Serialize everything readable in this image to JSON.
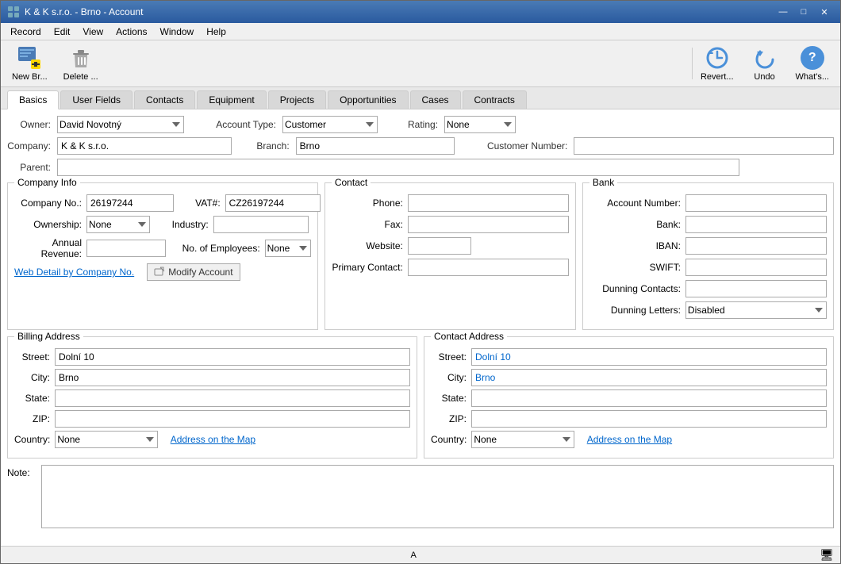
{
  "titlebar": {
    "icon": "⚙",
    "title": "K & K s.r.o. - Brno - Account",
    "minimize": "—",
    "maximize": "□",
    "close": "✕"
  },
  "menubar": {
    "items": [
      "Record",
      "Edit",
      "View",
      "Actions",
      "Window",
      "Help"
    ]
  },
  "toolbar": {
    "new_br_label": "New Br...",
    "delete_label": "Delete ...",
    "revert_label": "Revert...",
    "undo_label": "Undo",
    "whats_label": "What's..."
  },
  "tabs": [
    "Basics",
    "User Fields",
    "Contacts",
    "Equipment",
    "Projects",
    "Opportunities",
    "Cases",
    "Contracts"
  ],
  "active_tab": "Basics",
  "form": {
    "owner_label": "Owner:",
    "owner_value": "David Novotný",
    "account_type_label": "Account Type:",
    "account_type_value": "Customer",
    "rating_label": "Rating:",
    "rating_value": "None",
    "company_label": "Company:",
    "company_value": "K & K s.r.o.",
    "branch_label": "Branch:",
    "branch_value": "Brno",
    "customer_number_label": "Customer Number:",
    "customer_number_value": "",
    "parent_label": "Parent:",
    "parent_value": ""
  },
  "company_info": {
    "title": "Company Info",
    "company_no_label": "Company No.:",
    "company_no_value": "26197244",
    "vat_label": "VAT#:",
    "vat_value": "CZ26197244",
    "ownership_label": "Ownership:",
    "ownership_value": "None",
    "industry_label": "Industry:",
    "industry_value": "",
    "annual_revenue_label": "Annual Revenue:",
    "annual_revenue_value": "",
    "no_employees_label": "No. of Employees:",
    "no_employees_value": "None",
    "web_detail_link": "Web Detail by Company No.",
    "modify_account_label": "Modify Account"
  },
  "contact_section": {
    "title": "Contact",
    "phone_label": "Phone:",
    "phone_value": "",
    "fax_label": "Fax:",
    "fax_value": "",
    "website_label": "Website:",
    "website_value": "",
    "primary_contact_label": "Primary Contact:",
    "primary_contact_value": ""
  },
  "bank_section": {
    "title": "Bank",
    "account_number_label": "Account Number:",
    "account_number_value": "",
    "bank_label": "Bank:",
    "bank_value": "",
    "iban_label": "IBAN:",
    "iban_value": "",
    "swift_label": "SWIFT:",
    "swift_value": "",
    "dunning_contacts_label": "Dunning Contacts:",
    "dunning_contacts_value": "",
    "dunning_letters_label": "Dunning Letters:",
    "dunning_letters_value": "Disabled"
  },
  "billing_address": {
    "title": "Billing Address",
    "street_label": "Street:",
    "street_value": "Dolní 10",
    "city_label": "City:",
    "city_value": "Brno",
    "state_label": "State:",
    "state_value": "",
    "zip_label": "ZIP:",
    "zip_value": "",
    "country_label": "Country:",
    "country_value": "None",
    "map_link": "Address on the Map"
  },
  "contact_address": {
    "title": "Contact Address",
    "street_label": "Street:",
    "street_value": "Dolní 10",
    "city_label": "City:",
    "city_value": "Brno",
    "state_label": "State:",
    "state_value": "",
    "zip_label": "ZIP:",
    "zip_value": "",
    "country_label": "Country:",
    "country_value": "None",
    "map_link": "Address on the Map"
  },
  "note": {
    "label": "Note:",
    "value": ""
  },
  "statusbar": {
    "indicator": "A",
    "monitor_icon": "🖥"
  }
}
